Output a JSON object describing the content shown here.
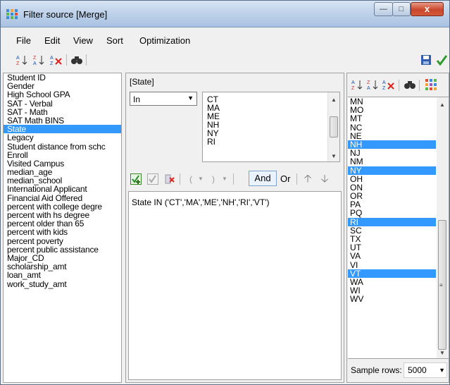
{
  "window": {
    "title": "Filter source  [Merge]",
    "min_glyph": "—",
    "max_glyph": "□",
    "close_glyph": "x"
  },
  "menu": [
    {
      "label": "File"
    },
    {
      "label": "Edit"
    },
    {
      "label": "View"
    },
    {
      "label": "Sort"
    },
    {
      "label": "Optimization"
    }
  ],
  "toolbar": {
    "icons": [
      "sort-ascending-icon",
      "sort-descending-icon",
      "clear-sort-icon",
      "find-icon",
      "save-icon",
      "ok-checkmark-icon"
    ]
  },
  "fields": [
    "Student ID",
    "Gender",
    "High School GPA",
    "SAT - Verbal",
    "SAT - Math",
    "SAT Math BINS",
    "State",
    "Legacy",
    "Student distance from schc",
    "Enroll",
    "Visited Campus",
    "median_age",
    "median_school",
    "International Applicant",
    "Financial Aid Offered",
    "percent with college degre",
    "percent with hs degree",
    "percent older than 65",
    "percent with kids",
    "percent poverty",
    "percent public assistance",
    "Major_CD",
    "scholarship_amt",
    "loan_amt",
    "work_study_amt"
  ],
  "selected_field": "State",
  "filter": {
    "field_label": "[State]",
    "operator": "In",
    "values": [
      "CT",
      "MA",
      "ME",
      "NH",
      "NY",
      "RI"
    ],
    "and_label": "And",
    "or_label": "Or",
    "expression": "State IN ('CT','MA','ME','NH','RI','VT')"
  },
  "states": [
    {
      "v": "MN",
      "sel": false
    },
    {
      "v": "MO",
      "sel": false
    },
    {
      "v": "MT",
      "sel": false
    },
    {
      "v": "NC",
      "sel": false
    },
    {
      "v": "NE",
      "sel": false
    },
    {
      "v": "NH",
      "sel": true
    },
    {
      "v": "NJ",
      "sel": false
    },
    {
      "v": "NM",
      "sel": false
    },
    {
      "v": "NY",
      "sel": true
    },
    {
      "v": "OH",
      "sel": false
    },
    {
      "v": "ON",
      "sel": false
    },
    {
      "v": "OR",
      "sel": false
    },
    {
      "v": "PA",
      "sel": false
    },
    {
      "v": "PQ",
      "sel": false
    },
    {
      "v": "RI",
      "sel": true
    },
    {
      "v": "SC",
      "sel": false
    },
    {
      "v": "TX",
      "sel": false
    },
    {
      "v": "UT",
      "sel": false
    },
    {
      "v": "VA",
      "sel": false
    },
    {
      "v": "VI",
      "sel": false
    },
    {
      "v": "VT",
      "sel": true
    },
    {
      "v": "WA",
      "sel": false
    },
    {
      "v": "WI",
      "sel": false
    },
    {
      "v": "WV",
      "sel": false
    }
  ],
  "sample": {
    "label": "Sample rows:",
    "value": "5000"
  },
  "colors": {
    "selection": "#3399ff",
    "titlebar": "#bdd1ea",
    "close": "#c9472b"
  }
}
